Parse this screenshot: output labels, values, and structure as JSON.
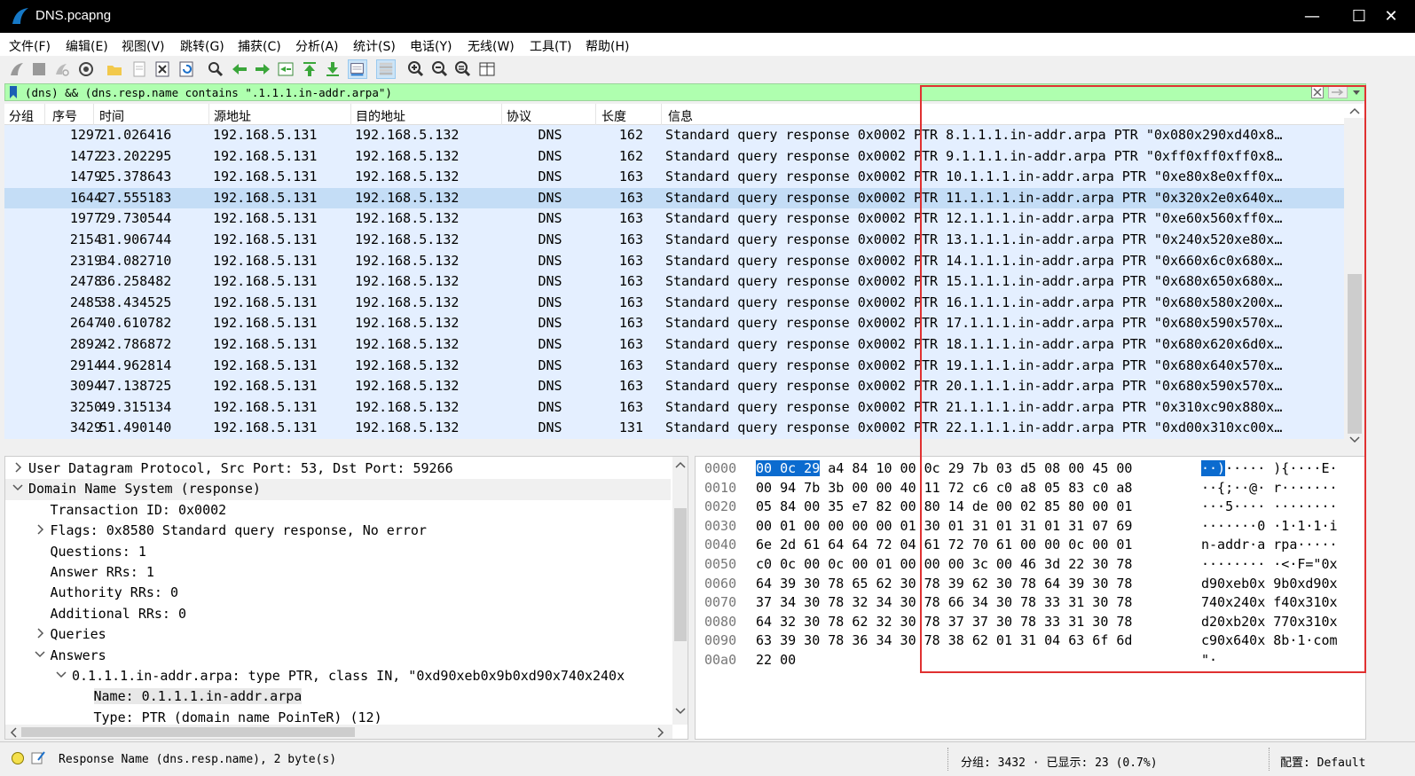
{
  "window": {
    "title": "DNS.pcapng",
    "close_glyph": "✕",
    "max_glyph": "☐",
    "min_glyph": "—"
  },
  "menu": [
    "文件(F)",
    "编辑(E)",
    "视图(V)",
    "跳转(G)",
    "捕获(C)",
    "分析(A)",
    "统计(S)",
    "电话(Y)",
    "无线(W)",
    "工具(T)",
    "帮助(H)"
  ],
  "filter": {
    "value": "(dns) && (dns.resp.name contains \".1.1.1.in-addr.arpa\")",
    "plus": "+"
  },
  "columns": [
    "分组",
    "序号",
    "时间",
    "源地址",
    "目的地址",
    "协议",
    "长度",
    "信息"
  ],
  "packets": [
    {
      "no": "1297",
      "time": "21.026416",
      "src": "192.168.5.131",
      "dst": "192.168.5.132",
      "proto": "DNS",
      "len": "162",
      "info": "Standard query response 0x0002 PTR 8.1.1.1.in-addr.arpa PTR \"0x080x290xd40x8…"
    },
    {
      "no": "1472",
      "time": "23.202295",
      "src": "192.168.5.131",
      "dst": "192.168.5.132",
      "proto": "DNS",
      "len": "162",
      "info": "Standard query response 0x0002 PTR 9.1.1.1.in-addr.arpa PTR \"0xff0xff0xff0x8…"
    },
    {
      "no": "1479",
      "time": "25.378643",
      "src": "192.168.5.131",
      "dst": "192.168.5.132",
      "proto": "DNS",
      "len": "163",
      "info": "Standard query response 0x0002 PTR 10.1.1.1.in-addr.arpa PTR \"0xe80x8e0xff0x…"
    },
    {
      "no": "1644",
      "time": "27.555183",
      "src": "192.168.5.131",
      "dst": "192.168.5.132",
      "proto": "DNS",
      "len": "163",
      "info": "Standard query response 0x0002 PTR 11.1.1.1.in-addr.arpa PTR \"0x320x2e0x640x…"
    },
    {
      "no": "1977",
      "time": "29.730544",
      "src": "192.168.5.131",
      "dst": "192.168.5.132",
      "proto": "DNS",
      "len": "163",
      "info": "Standard query response 0x0002 PTR 12.1.1.1.in-addr.arpa PTR \"0xe60x560xff0x…"
    },
    {
      "no": "2154",
      "time": "31.906744",
      "src": "192.168.5.131",
      "dst": "192.168.5.132",
      "proto": "DNS",
      "len": "163",
      "info": "Standard query response 0x0002 PTR 13.1.1.1.in-addr.arpa PTR \"0x240x520xe80x…"
    },
    {
      "no": "2319",
      "time": "34.082710",
      "src": "192.168.5.131",
      "dst": "192.168.5.132",
      "proto": "DNS",
      "len": "163",
      "info": "Standard query response 0x0002 PTR 14.1.1.1.in-addr.arpa PTR \"0x660x6c0x680x…"
    },
    {
      "no": "2478",
      "time": "36.258482",
      "src": "192.168.5.131",
      "dst": "192.168.5.132",
      "proto": "DNS",
      "len": "163",
      "info": "Standard query response 0x0002 PTR 15.1.1.1.in-addr.arpa PTR \"0x680x650x680x…"
    },
    {
      "no": "2485",
      "time": "38.434525",
      "src": "192.168.5.131",
      "dst": "192.168.5.132",
      "proto": "DNS",
      "len": "163",
      "info": "Standard query response 0x0002 PTR 16.1.1.1.in-addr.arpa PTR \"0x680x580x200x…"
    },
    {
      "no": "2647",
      "time": "40.610782",
      "src": "192.168.5.131",
      "dst": "192.168.5.132",
      "proto": "DNS",
      "len": "163",
      "info": "Standard query response 0x0002 PTR 17.1.1.1.in-addr.arpa PTR \"0x680x590x570x…"
    },
    {
      "no": "2892",
      "time": "42.786872",
      "src": "192.168.5.131",
      "dst": "192.168.5.132",
      "proto": "DNS",
      "len": "163",
      "info": "Standard query response 0x0002 PTR 18.1.1.1.in-addr.arpa PTR \"0x680x620x6d0x…"
    },
    {
      "no": "2914",
      "time": "44.962814",
      "src": "192.168.5.131",
      "dst": "192.168.5.132",
      "proto": "DNS",
      "len": "163",
      "info": "Standard query response 0x0002 PTR 19.1.1.1.in-addr.arpa PTR \"0x680x640x570x…"
    },
    {
      "no": "3094",
      "time": "47.138725",
      "src": "192.168.5.131",
      "dst": "192.168.5.132",
      "proto": "DNS",
      "len": "163",
      "info": "Standard query response 0x0002 PTR 20.1.1.1.in-addr.arpa PTR \"0x680x590x570x…"
    },
    {
      "no": "3250",
      "time": "49.315134",
      "src": "192.168.5.131",
      "dst": "192.168.5.132",
      "proto": "DNS",
      "len": "163",
      "info": "Standard query response 0x0002 PTR 21.1.1.1.in-addr.arpa PTR \"0x310xc90x880x…"
    },
    {
      "no": "3429",
      "time": "51.490140",
      "src": "192.168.5.131",
      "dst": "192.168.5.132",
      "proto": "DNS",
      "len": "131",
      "info": "Standard query response 0x0002 PTR 22.1.1.1.in-addr.arpa PTR \"0xd00x310xc00x…"
    }
  ],
  "selected_packet": "1644",
  "tree": [
    {
      "text": "User Datagram Protocol, Src Port: 53, Dst Port: 59266",
      "indent": 0,
      "arrow": "right"
    },
    {
      "text": "Domain Name System (response)",
      "indent": 0,
      "arrow": "down",
      "band": true
    },
    {
      "text": "Transaction ID: 0x0002",
      "indent": 1,
      "arrow": ""
    },
    {
      "text": "Flags: 0x8580 Standard query response, No error",
      "indent": 1,
      "arrow": "right"
    },
    {
      "text": "Questions: 1",
      "indent": 1,
      "arrow": ""
    },
    {
      "text": "Answer RRs: 1",
      "indent": 1,
      "arrow": ""
    },
    {
      "text": "Authority RRs: 0",
      "indent": 1,
      "arrow": ""
    },
    {
      "text": "Additional RRs: 0",
      "indent": 1,
      "arrow": ""
    },
    {
      "text": "Queries",
      "indent": 1,
      "arrow": "right"
    },
    {
      "text": "Answers",
      "indent": 1,
      "arrow": "down"
    },
    {
      "text": "0.1.1.1.in-addr.arpa: type PTR, class IN, \"0xd90xeb0x9b0xd90x740x240x",
      "indent": 2,
      "arrow": "down"
    },
    {
      "text": "Name: 0.1.1.1.in-addr.arpa",
      "indent": 3,
      "arrow": "",
      "hl": true
    },
    {
      "text": "Type: PTR (domain name PoinTeR) (12)",
      "indent": 3,
      "arrow": ""
    }
  ],
  "hex": [
    {
      "off": "0000",
      "bytes": "00 0c 29 a4 84 10 00 0c  29 7b 03 d5 08 00 45 00",
      "ascii": "··)·····  ){····E·"
    },
    {
      "off": "0010",
      "bytes": "00 94 7b 3b 00 00 40 11  72 c6 c0 a8 05 83 c0 a8",
      "ascii": "··{;··@·  r·······"
    },
    {
      "off": "0020",
      "bytes": "05 84 00 35 e7 82 00 80  14 de 00 02 85 80 00 01",
      "ascii": "···5····  ········"
    },
    {
      "off": "0030",
      "bytes": "00 01 00 00 00 00 01 30  01 31 01 31 01 31 07 69",
      "ascii": "·······0  ·1·1·1·i"
    },
    {
      "off": "0040",
      "bytes": "6e 2d 61 64 64 72 04 61  72 70 61 00 00 0c 00 01",
      "ascii": "n-addr·a  rpa·····"
    },
    {
      "off": "0050",
      "bytes": "c0 0c 00 0c 00 01 00 00  00 3c 00 46 3d 22 30 78",
      "ascii": "········  ·<·F=\"0x"
    },
    {
      "off": "0060",
      "bytes": "64 39 30 78 65 62 30 78  39 62 30 78 64 39 30 78",
      "ascii": "d90xeb0x  9b0xd90x"
    },
    {
      "off": "0070",
      "bytes": "37 34 30 78 32 34 30 78  66 34 30 78 33 31 30 78",
      "ascii": "740x240x  f40x310x"
    },
    {
      "off": "0080",
      "bytes": "64 32 30 78 62 32 30 78  37 37 30 78 33 31 30 78",
      "ascii": "d20xb20x  770x310x"
    },
    {
      "off": "0090",
      "bytes": "63 39 30 78 36 34 30 78  38 62 01 31 04 63 6f 6d",
      "ascii": "c90x640x  8b·1·com"
    },
    {
      "off": "00a0",
      "bytes": "22 00",
      "ascii": "\"·"
    }
  ],
  "hex_highlight": {
    "bytes": "00 0c 29",
    "ascii": "··)"
  },
  "status": {
    "field": "Response Name (dns.resp.name), 2 byte(s)",
    "packets": "分组: 3432 · 已显示: 23 (0.7%)",
    "profile": "配置: Default"
  },
  "colors": {
    "row_bg": "#e4efff",
    "row_selected": "#c4ddf6",
    "filter_bg": "#afffaf",
    "annotation": "#e03131"
  }
}
